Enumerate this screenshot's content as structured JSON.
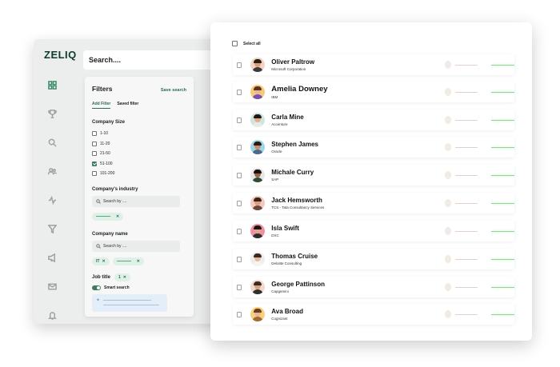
{
  "app": {
    "logo": "ZELIQ",
    "search_text": "Search...."
  },
  "filters": {
    "title": "Filters",
    "save_label": "Save search",
    "tabs": [
      {
        "label": "Add Filter",
        "active": true
      },
      {
        "label": "Saved filter",
        "active": false
      }
    ],
    "company_size": {
      "label": "Company Size",
      "options": [
        {
          "label": "1-10",
          "checked": false
        },
        {
          "label": "11-20",
          "checked": false
        },
        {
          "label": "21-50",
          "checked": false
        },
        {
          "label": "51-100",
          "checked": true
        },
        {
          "label": "101-200",
          "checked": false
        }
      ]
    },
    "industry": {
      "label": "Company's industry",
      "placeholder": "Search by ...."
    },
    "company_name": {
      "label": "Company name",
      "placeholder": "Search by ....",
      "chip": "IT"
    },
    "job_title": {
      "label": "Job title",
      "count": "1"
    },
    "smart_search": {
      "label": "Smart search",
      "enabled": true
    },
    "chip_close": "✕"
  },
  "results": {
    "select_all_label": "Select all",
    "people": [
      {
        "name": "Oliver Paltrow",
        "company": "Microsoft Corporation",
        "avatar_bg": "#f2d3c4",
        "shirt": "#3b3b3b",
        "hair": "#2b1d16",
        "skin": "#d9a07f"
      },
      {
        "name": "Amelia Downey",
        "company": "IBM",
        "avatar_bg": "#f7c97a",
        "shirt": "#7a4fb0",
        "hair": "#5a3420",
        "skin": "#e8b896"
      },
      {
        "name": "Carla Mine",
        "company": "Accenture",
        "avatar_bg": "#cfe5dd",
        "shirt": "#e9e9e9",
        "hair": "#1e1714",
        "skin": "#e2ab8d"
      },
      {
        "name": "Stephen James",
        "company": "Oracle",
        "avatar_bg": "#9fd4e8",
        "shirt": "#4b6b8a",
        "hair": "#2a1a10",
        "skin": "#c98c6a"
      },
      {
        "name": "Michale Curry",
        "company": "SAP",
        "avatar_bg": "#e8e8e8",
        "shirt": "#2f4a35",
        "hair": "#17110d",
        "skin": "#9c6646"
      },
      {
        "name": "Jack Hemsworth",
        "company": "TCS - Tata Consultancy Services",
        "avatar_bg": "#f3c9c0",
        "shirt": "#6b4a3a",
        "hair": "#3a2418",
        "skin": "#d7a084"
      },
      {
        "name": "Isla Swift",
        "company": "DXC",
        "avatar_bg": "#f08fa3",
        "shirt": "#2d2d2d",
        "hair": "#1b1310",
        "skin": "#e0a88a"
      },
      {
        "name": "Thomas Cruise",
        "company": "Deloitte Consulting",
        "avatar_bg": "#eeeeee",
        "shirt": "#f4f4f4",
        "hair": "#3a2a22",
        "skin": "#e6b99a"
      },
      {
        "name": "George Pattinson",
        "company": "Capgemini",
        "avatar_bg": "#f2d9cf",
        "shirt": "#2f2f2f",
        "hair": "#3b2a20",
        "skin": "#d9a07f"
      },
      {
        "name": "Ava Broad",
        "company": "Cognizant",
        "avatar_bg": "#f7d27d",
        "shirt": "#a36a3a",
        "hair": "#6b3d22",
        "skin": "#e8b896"
      }
    ]
  },
  "colors": {
    "accent": "#2e6b52",
    "check": "#3d7a60",
    "email_line": "#8fd48f"
  }
}
